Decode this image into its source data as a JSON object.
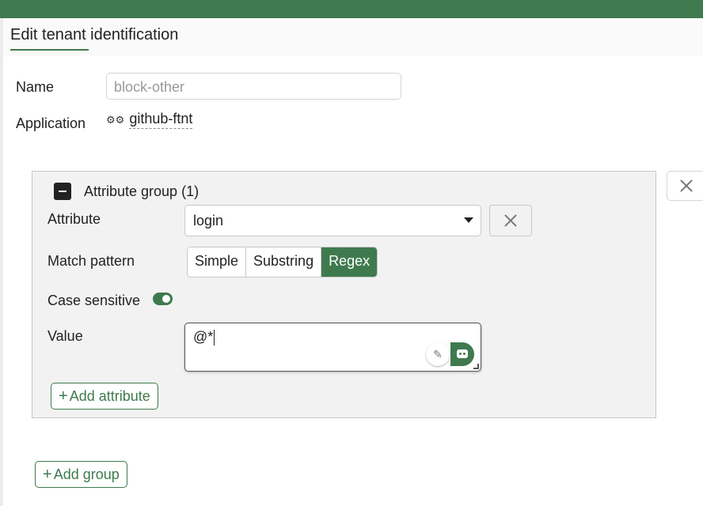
{
  "dialog": {
    "title": "Edit tenant identification"
  },
  "form": {
    "name_label": "Name",
    "name_placeholder": "block-other",
    "application_label": "Application",
    "application_value": "github-ftnt"
  },
  "group": {
    "title": "Attribute group (1)",
    "attribute_label": "Attribute",
    "attribute_value": "login",
    "match_label": "Match pattern",
    "match_options": [
      "Simple",
      "Substring",
      "Regex"
    ],
    "match_selected": "Regex",
    "case_label": "Case sensitive",
    "case_sensitive": true,
    "value_label": "Value",
    "value": "@*",
    "add_attribute_label": "Add attribute"
  },
  "add_group_label": "Add group",
  "colors": {
    "accent": "#3f7a4e",
    "topbar": "#3f7a4e"
  },
  "icons": {
    "application": "gears-icon",
    "collapse": "minus-square-icon",
    "dropdown": "caret-down-icon",
    "clear": "close-icon",
    "feather": "feather-icon",
    "assistant": "robot-icon"
  }
}
